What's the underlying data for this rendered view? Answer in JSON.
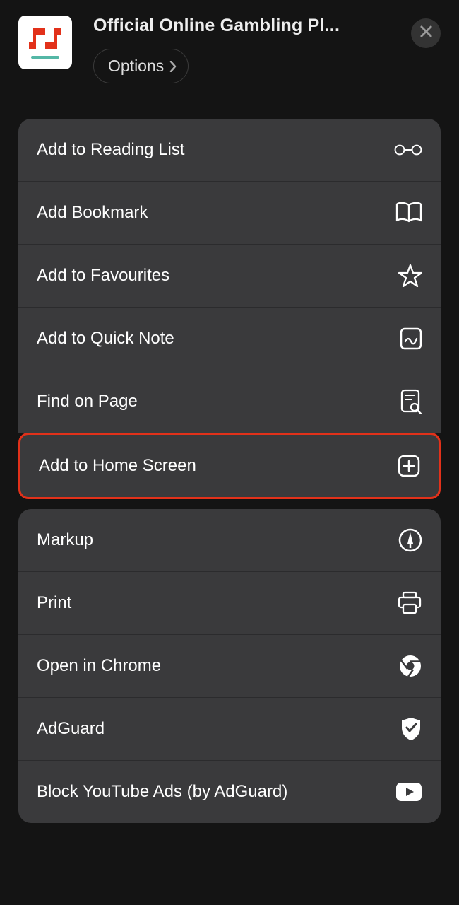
{
  "header": {
    "title": "Official Online Gambling Pl...",
    "options_label": "Options"
  },
  "menu1": [
    {
      "label": "Add to Reading List"
    },
    {
      "label": "Add Bookmark"
    },
    {
      "label": "Add to Favourites"
    },
    {
      "label": "Add to Quick Note"
    },
    {
      "label": "Find on Page"
    }
  ],
  "highlighted": {
    "label": "Add to Home Screen"
  },
  "menu2": [
    {
      "label": "Markup"
    },
    {
      "label": "Print"
    },
    {
      "label": "Open in Chrome"
    },
    {
      "label": "AdGuard"
    },
    {
      "label": "Block YouTube Ads (by AdGuard)"
    }
  ]
}
